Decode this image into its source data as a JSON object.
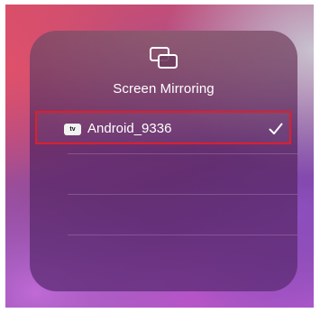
{
  "screen_mirroring": {
    "title": "Screen Mirroring",
    "icon": "screen-mirroring-icon",
    "devices": [
      {
        "badge": "tv",
        "name": "Android_9336",
        "selected": true
      }
    ]
  },
  "colors": {
    "highlight_border": "#e01e2a",
    "text": "#ffffff"
  }
}
